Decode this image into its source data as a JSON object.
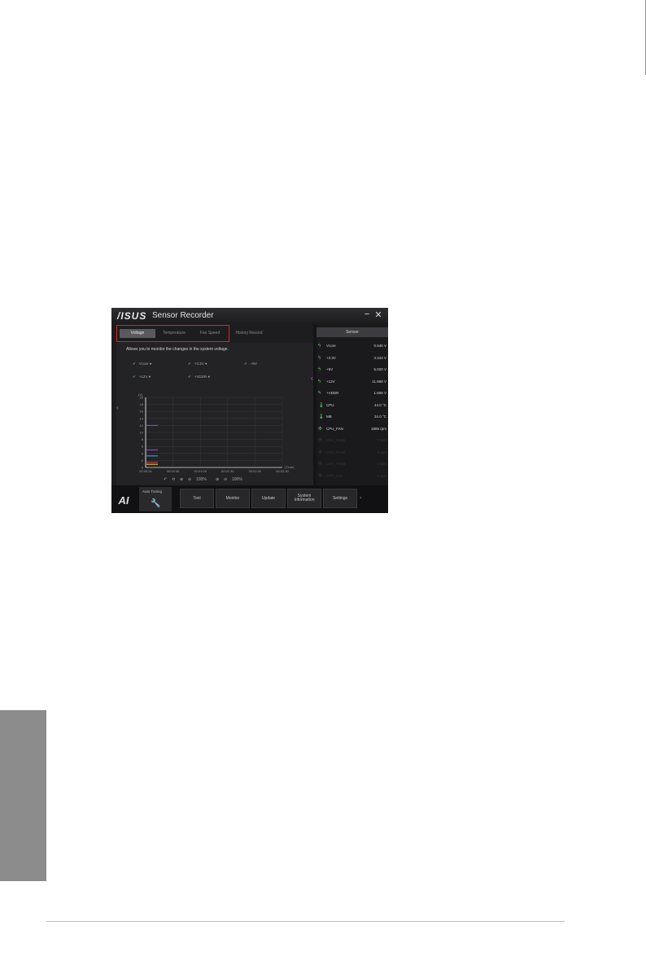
{
  "window": {
    "brand": "/ISUS",
    "title": "Sensor Recorder",
    "minimize_glyph": "−",
    "close_glyph": "✕"
  },
  "tabs": [
    {
      "label": "Voltage",
      "active": true
    },
    {
      "label": "Temperature",
      "active": false
    },
    {
      "label": "Fan Speed",
      "active": false
    },
    {
      "label": "History Record",
      "active": false
    }
  ],
  "description": "Allows you to monitor the changes in the system voltage.",
  "checkboxes": [
    {
      "label": "Vcore ●",
      "checked": true
    },
    {
      "label": "+3.3V ●",
      "checked": true
    },
    {
      "label": "+5V",
      "checked": true
    },
    {
      "label": "+12V ●",
      "checked": true
    },
    {
      "label": "+VDDR ●",
      "checked": true
    }
  ],
  "sensor_panel": {
    "button_label": "Sensor",
    "rows": [
      {
        "icon": "voltage-icon",
        "name": "Vcore",
        "value": "0.946 V",
        "active": true
      },
      {
        "icon": "voltage-icon",
        "name": "+3.3V",
        "value": "3.344 V",
        "active": true
      },
      {
        "icon": "voltage-icon",
        "name": "+5V",
        "value": "5.020 V",
        "active": true
      },
      {
        "icon": "voltage-icon",
        "name": "+12V",
        "value": "11.968 V",
        "active": true
      },
      {
        "icon": "voltage-icon",
        "name": "+VDDR",
        "value": "1.506 V",
        "active": true
      },
      {
        "icon": "temperature-icon",
        "name": "CPU",
        "value": "44.0 °C",
        "active": true
      },
      {
        "icon": "temperature-icon",
        "name": "MB",
        "value": "34.0 °C",
        "active": true
      },
      {
        "icon": "fan-icon",
        "name": "CPU_FAN",
        "value": "1985 rpm",
        "active": true
      },
      {
        "icon": "fan-icon",
        "name": "CHA_FAN1",
        "value": "0 rpm",
        "active": false
      },
      {
        "icon": "fan-icon",
        "name": "CHA_FAN2",
        "value": "0 rpm",
        "active": false
      },
      {
        "icon": "fan-icon",
        "name": "CHA_FAN3",
        "value": "0 rpm",
        "active": false
      },
      {
        "icon": "fan-icon",
        "name": "OPT_FAN",
        "value": "0 rpm",
        "active": false
      }
    ]
  },
  "chart_data": {
    "type": "line",
    "ylabel": "(V)",
    "xlabel": "(Time)",
    "ylim": [
      0,
      20
    ],
    "y_ticks": [
      "0",
      "2",
      "4",
      "6",
      "8",
      "10",
      "12",
      "14",
      "16",
      "18",
      "20"
    ],
    "x_ticks": [
      "00:00:00",
      "00:00:30",
      "00:01:00",
      "00:01:30",
      "00:02:00",
      "00:02:30"
    ],
    "grid": true,
    "series": [
      {
        "color": "#4a5fd6",
        "values": [
          12,
          12
        ]
      },
      {
        "color": "#8a46c8",
        "values": [
          5,
          5
        ]
      },
      {
        "color": "#3c8cf0",
        "values": [
          3.3,
          3.3
        ]
      },
      {
        "color": "#c93a3a",
        "values": [
          1.5,
          1.5
        ]
      },
      {
        "color": "#d6c23a",
        "values": [
          0.9,
          0.9
        ]
      }
    ],
    "toolbar": {
      "zoom_a": "100%",
      "zoom_b": "100%"
    }
  },
  "bottom_nav": {
    "auto_tuning": "Auto Tuning",
    "items": [
      "Tool",
      "Monitor",
      "Update",
      "System Information",
      "Settings"
    ]
  },
  "colors": {
    "accent_outline": "#d4272a",
    "window_bg": "#1d1d1f"
  }
}
